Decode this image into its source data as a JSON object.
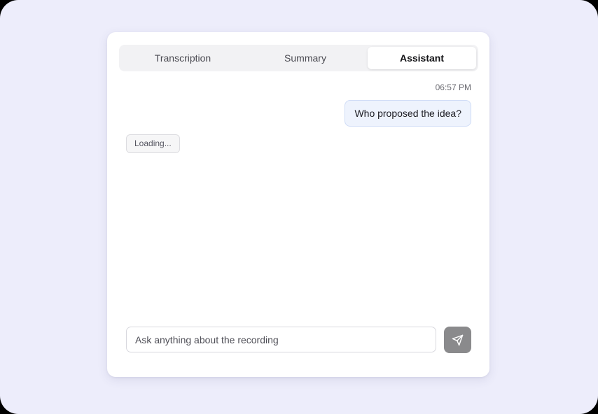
{
  "tabs": [
    {
      "label": "Transcription",
      "active": false
    },
    {
      "label": "Summary",
      "active": false
    },
    {
      "label": "Assistant",
      "active": true
    }
  ],
  "chat": {
    "timestamp": "06:57 PM",
    "user_message": "Who proposed the idea?",
    "assistant_status": "Loading..."
  },
  "composer": {
    "placeholder": "Ask anything about the recording",
    "value": "",
    "send_icon": "send-icon"
  },
  "colors": {
    "background": "#ededfb",
    "card": "#ffffff",
    "user_bubble": "#eef3fd",
    "send_button": "#8a8a8c"
  }
}
